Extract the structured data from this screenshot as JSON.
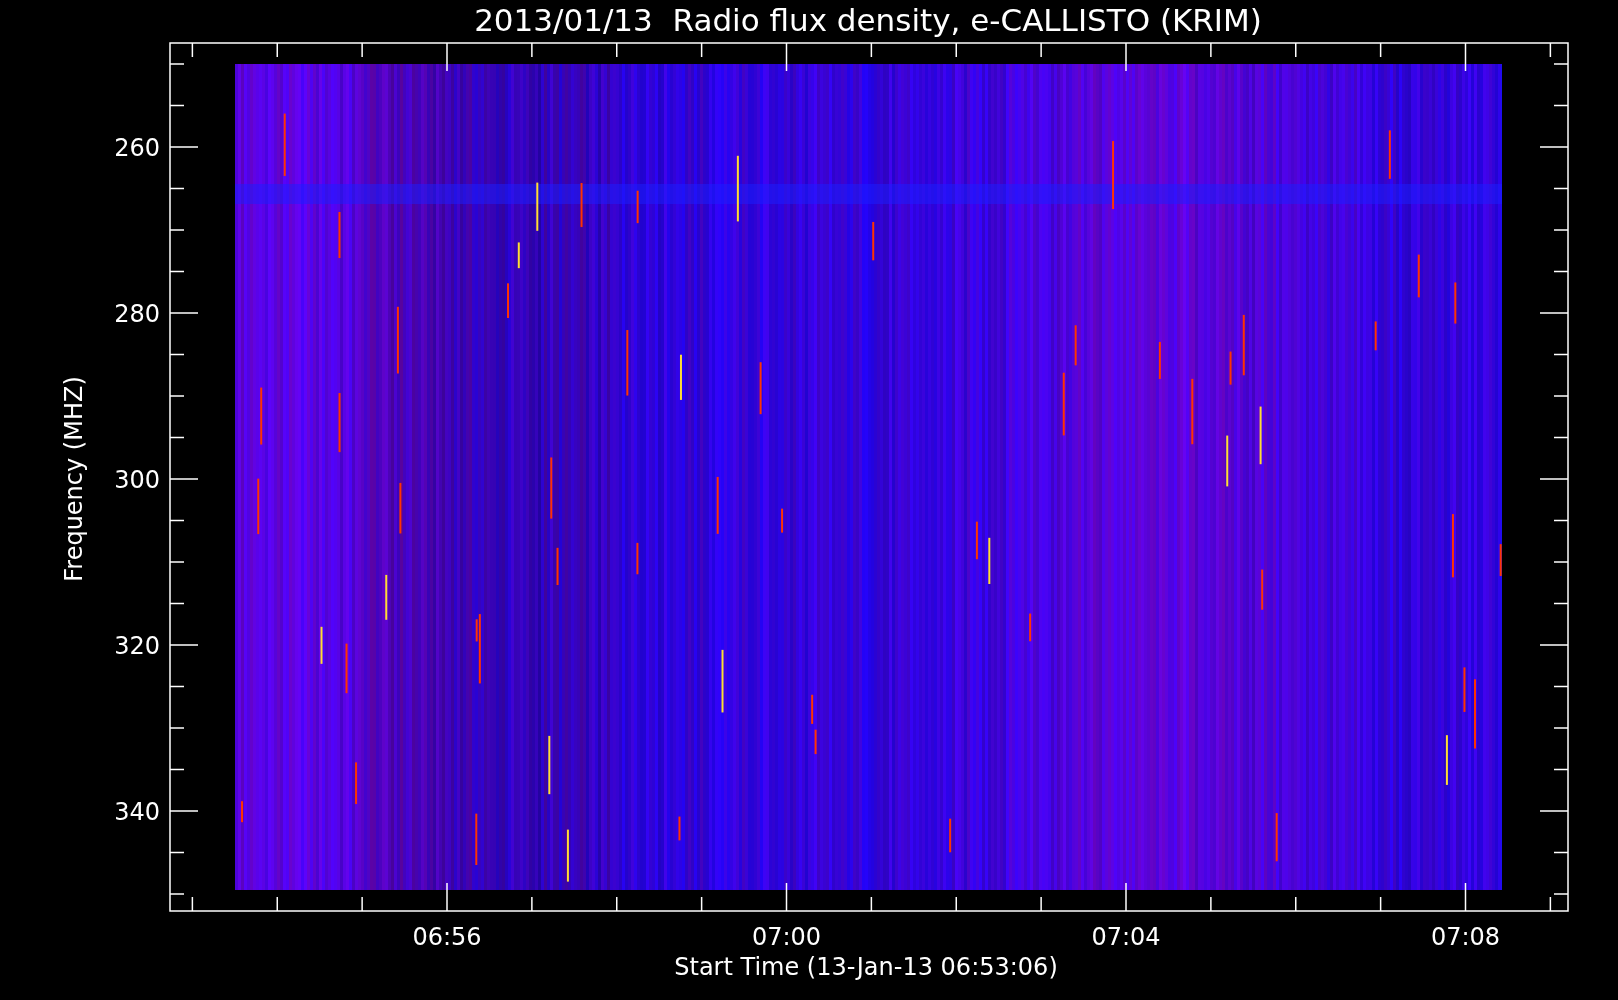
{
  "title": "2013/01/13  Radio flux density, e-CALLISTO (KRIM)",
  "y_axis": {
    "label": "Frequency (MHZ)",
    "ticks": [
      "260",
      "280",
      "300",
      "320",
      "340"
    ]
  },
  "x_axis": {
    "label": "Start Time (13-Jan-13 06:53:06)",
    "ticks": [
      "06:56",
      "07:00",
      "07:04",
      "07:08"
    ]
  }
}
